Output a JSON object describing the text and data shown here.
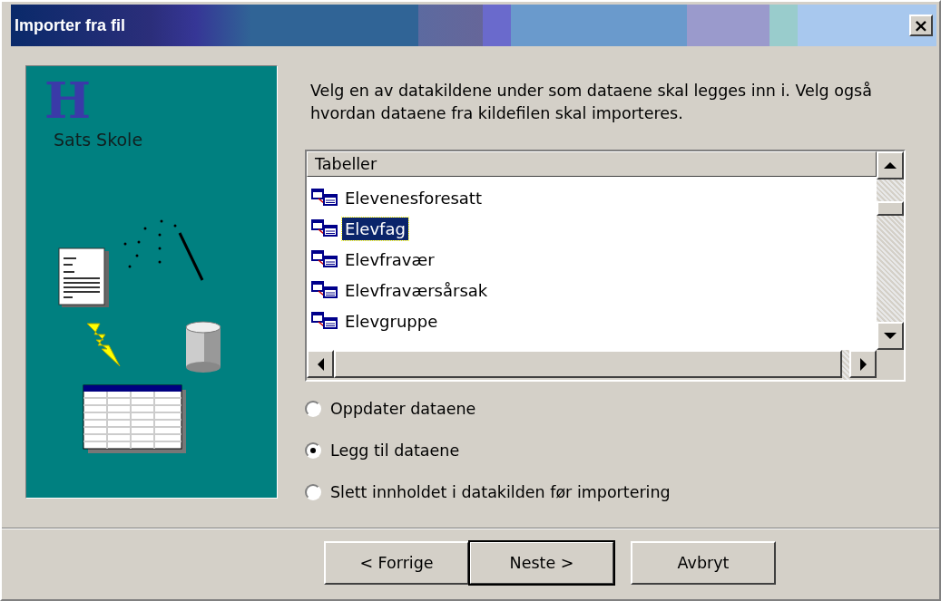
{
  "window": {
    "title": "Importer fra fil",
    "close": "×"
  },
  "sidebar": {
    "logo": "H",
    "brand": "Sats Skole"
  },
  "instructions": "Velg en av datakildene under som dataene skal legges inn i. Velg også hvordan dataene fra kildefilen skal importeres.",
  "list": {
    "header": "Tabeller",
    "items": [
      {
        "label": "Elevenesforesatt",
        "selected": false
      },
      {
        "label": "Elevfag",
        "selected": true
      },
      {
        "label": "Elevfravær",
        "selected": false
      },
      {
        "label": "Elevfraværsårsak",
        "selected": false
      },
      {
        "label": "Elevgruppe",
        "selected": false
      }
    ]
  },
  "options": [
    {
      "label": "Oppdater dataene",
      "selected": false
    },
    {
      "label": "Legg til dataene",
      "selected": true
    },
    {
      "label": "Slett innholdet i datakilden før importering",
      "selected": false
    }
  ],
  "buttons": [
    {
      "label": "< Forrige",
      "default": false
    },
    {
      "label": "Neste >",
      "default": true
    },
    {
      "label": "Avbryt",
      "default": false
    }
  ]
}
